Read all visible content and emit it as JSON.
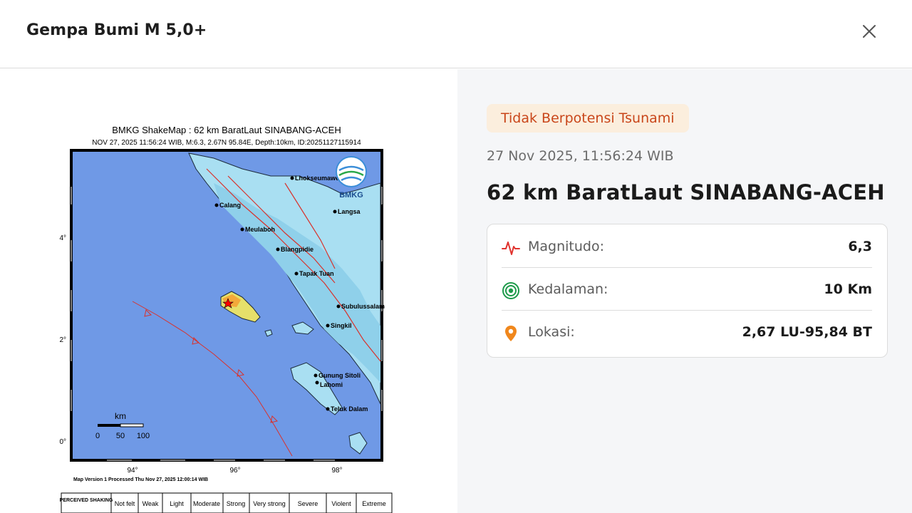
{
  "header": {
    "title": "Gempa Bumi M 5,0+"
  },
  "shakemap": {
    "title": "BMKG ShakeMap : 62 km BaratLaut SINABANG-ACEH",
    "subtitle": "NOV 27, 2025 11:56:24 WIB, M:6.3, 2.67N 95.84E, Depth:10km, ID:20251127115914",
    "logo_text": "BMKG",
    "lat_ticks": [
      "4°",
      "2°",
      "0°"
    ],
    "lon_ticks": [
      "94°",
      "96°",
      "98°"
    ],
    "places": [
      "Lhokseumawe",
      "Calang",
      "Meulaboh",
      "Blangpidie",
      "Tapak Tuan",
      "Langsa",
      "Subulussalam",
      "Singkil",
      "Gunung Sitoli",
      "Teluk Dalam",
      "Lahomi"
    ],
    "scale_label": "km",
    "scale_ticks": [
      "0",
      "50",
      "100"
    ],
    "footer": "Map Version 1 Processed Thu Nov 27, 2025 12:00:14 WIB",
    "legend_header": "PERCEIVED SHAKING",
    "legend_items": [
      "Not felt",
      "Weak",
      "Light",
      "Moderate",
      "Strong",
      "Very strong",
      "Severe",
      "Violent",
      "Extreme"
    ],
    "legend_colors": [
      "#ffffff",
      "#bfccff",
      "#a0e6ff",
      "#80ffff",
      "#7aff93",
      "#ffff00",
      "#ffc800",
      "#ff9100",
      "#ff0000"
    ]
  },
  "tsunami_badge": "Tidak Berpotensi Tsunami",
  "datetime": "27 Nov 2025, 11:56:24 WIB",
  "location_title": "62 km BaratLaut SINABANG-ACEH",
  "info": [
    {
      "icon": "activity-icon",
      "label": "Magnitudo:",
      "value": "6,3"
    },
    {
      "icon": "target-icon",
      "label": "Kedalaman:",
      "value": "10 Km"
    },
    {
      "icon": "map-pin-icon",
      "label": "Lokasi:",
      "value": "2,67 LU-95,84 BT"
    }
  ],
  "colors": {
    "accent": "#c9461a",
    "badge_bg": "#fbeedd",
    "pin": "#f0871c",
    "target": "#1d9a4a",
    "activity": "#e0322d",
    "sea": "#6f99e6"
  }
}
